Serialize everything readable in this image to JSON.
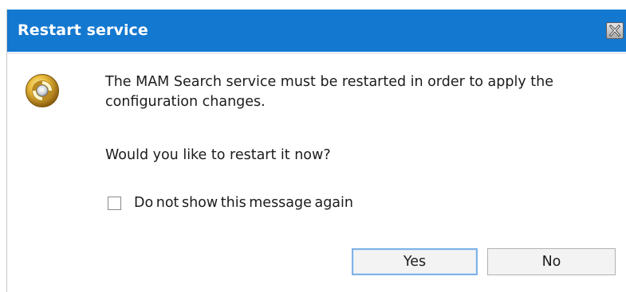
{
  "dialog": {
    "title": "Restart service",
    "close_icon": "close-icon",
    "app_icon": "restart-service-icon",
    "message": "The MAM Search service must be restarted in order to apply the configuration changes.",
    "question": "Would you like to restart it now?",
    "checkbox": {
      "label": "Do not show this message again",
      "checked": false
    },
    "buttons": {
      "yes_label": "Yes",
      "no_label": "No"
    }
  },
  "colors": {
    "titlebar": "#1378d0",
    "title_text": "#ffffff",
    "body_text": "#1c1c1c",
    "default_button_border": "#7fb2e6"
  }
}
